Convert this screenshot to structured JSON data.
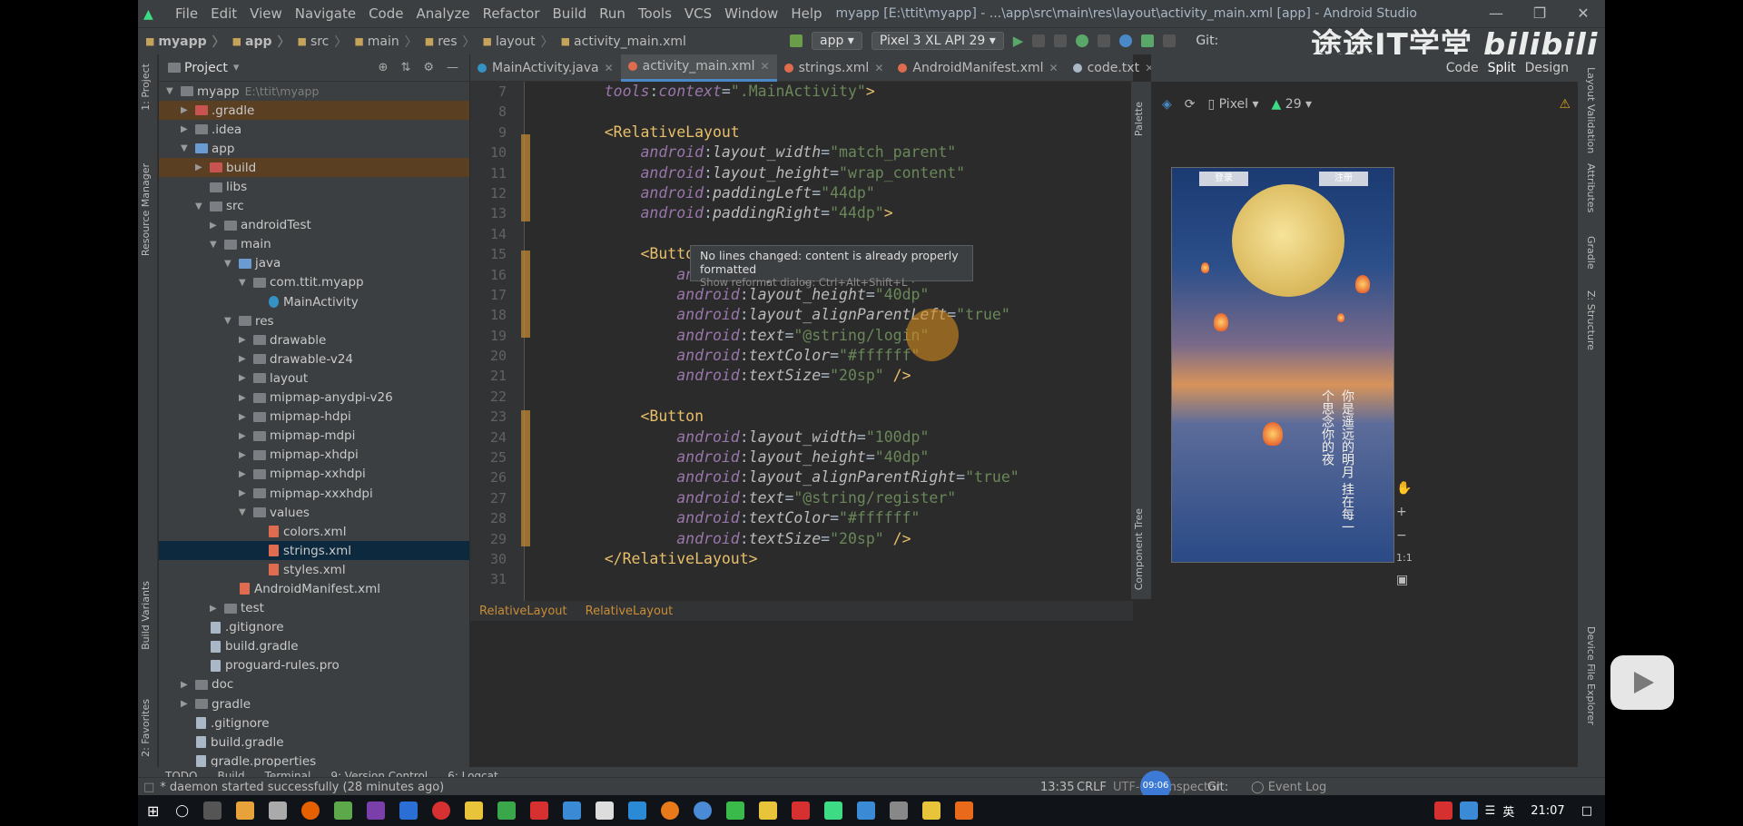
{
  "window": {
    "menu": [
      "File",
      "Edit",
      "View",
      "Navigate",
      "Code",
      "Analyze",
      "Refactor",
      "Build",
      "Run",
      "Tools",
      "VCS",
      "Window",
      "Help"
    ],
    "title": "myapp [E:\\ttit\\myapp] - ...\\app\\src\\main\\res\\layout\\activity_main.xml [app] - Android Studio"
  },
  "navbar": {
    "crumbs": [
      "myapp",
      "app",
      "src",
      "main",
      "res",
      "layout",
      "activity_main.xml"
    ],
    "run_config": "app",
    "device": "Pixel 3 XL API 29",
    "git_label": "Git:"
  },
  "watermark": {
    "text": "途途IT学堂",
    "brand": "bilibili"
  },
  "left_stripe": [
    "1: Project",
    "Resource Manager",
    "Build Variants",
    "2: Favorites"
  ],
  "project": {
    "title": "Project",
    "root_path": "E:\\ttit\\myapp",
    "tree": [
      {
        "label": "myapp",
        "depth": 0,
        "type": "folder",
        "expanded": true,
        "path": "E:\\ttit\\myapp"
      },
      {
        "label": ".gradle",
        "depth": 1,
        "type": "folder-red",
        "hl": true
      },
      {
        "label": ".idea",
        "depth": 1,
        "type": "folder"
      },
      {
        "label": "app",
        "depth": 1,
        "type": "folder-blue",
        "expanded": true
      },
      {
        "label": "build",
        "depth": 2,
        "type": "folder-red",
        "hl": true
      },
      {
        "label": "libs",
        "depth": 2,
        "type": "folder",
        "leaf": true
      },
      {
        "label": "src",
        "depth": 2,
        "type": "folder",
        "expanded": true
      },
      {
        "label": "androidTest",
        "depth": 3,
        "type": "folder"
      },
      {
        "label": "main",
        "depth": 3,
        "type": "folder",
        "expanded": true
      },
      {
        "label": "java",
        "depth": 4,
        "type": "folder-blue",
        "expanded": true
      },
      {
        "label": "com.ttit.myapp",
        "depth": 5,
        "type": "folder",
        "expanded": true
      },
      {
        "label": "MainActivity",
        "depth": 6,
        "type": "cls",
        "leaf": true
      },
      {
        "label": "res",
        "depth": 4,
        "type": "folder",
        "expanded": true
      },
      {
        "label": "drawable",
        "depth": 5,
        "type": "folder"
      },
      {
        "label": "drawable-v24",
        "depth": 5,
        "type": "folder"
      },
      {
        "label": "layout",
        "depth": 5,
        "type": "folder"
      },
      {
        "label": "mipmap-anydpi-v26",
        "depth": 5,
        "type": "folder"
      },
      {
        "label": "mipmap-hdpi",
        "depth": 5,
        "type": "folder"
      },
      {
        "label": "mipmap-mdpi",
        "depth": 5,
        "type": "folder"
      },
      {
        "label": "mipmap-xhdpi",
        "depth": 5,
        "type": "folder"
      },
      {
        "label": "mipmap-xxhdpi",
        "depth": 5,
        "type": "folder"
      },
      {
        "label": "mipmap-xxxhdpi",
        "depth": 5,
        "type": "folder"
      },
      {
        "label": "values",
        "depth": 5,
        "type": "folder",
        "expanded": true
      },
      {
        "label": "colors.xml",
        "depth": 6,
        "type": "xml",
        "leaf": true
      },
      {
        "label": "strings.xml",
        "depth": 6,
        "type": "xml",
        "leaf": true,
        "sel": true
      },
      {
        "label": "styles.xml",
        "depth": 6,
        "type": "xml",
        "leaf": true
      },
      {
        "label": "AndroidManifest.xml",
        "depth": 4,
        "type": "xml",
        "leaf": true
      },
      {
        "label": "test",
        "depth": 3,
        "type": "folder"
      },
      {
        "label": ".gitignore",
        "depth": 2,
        "type": "file",
        "leaf": true
      },
      {
        "label": "build.gradle",
        "depth": 2,
        "type": "file",
        "leaf": true
      },
      {
        "label": "proguard-rules.pro",
        "depth": 2,
        "type": "file",
        "leaf": true
      },
      {
        "label": "doc",
        "depth": 1,
        "type": "folder"
      },
      {
        "label": "gradle",
        "depth": 1,
        "type": "folder"
      },
      {
        "label": ".gitignore",
        "depth": 1,
        "type": "file",
        "leaf": true
      },
      {
        "label": "build.gradle",
        "depth": 1,
        "type": "file",
        "leaf": true
      },
      {
        "label": "gradle.properties",
        "depth": 1,
        "type": "file",
        "leaf": true
      }
    ]
  },
  "tabs": [
    {
      "label": "MainActivity.java",
      "color": "#3592c4"
    },
    {
      "label": "activity_main.xml",
      "color": "#e06c4f",
      "active": true
    },
    {
      "label": "strings.xml",
      "color": "#e06c4f"
    },
    {
      "label": "AndroidManifest.xml",
      "color": "#e06c4f"
    },
    {
      "label": "code.txt",
      "color": "#a9b7c6"
    }
  ],
  "editor": {
    "first_line": 7,
    "lines": [
      [
        [
          "ns",
          "    tools"
        ],
        [
          "pun",
          ":"
        ],
        [
          "ns",
          "context"
        ],
        [
          "pun",
          "="
        ],
        [
          "str",
          "\".MainActivity\""
        ],
        [
          "tag",
          ">"
        ]
      ],
      [],
      [
        [
          "tag",
          "    <RelativeLayout"
        ]
      ],
      [
        [
          "ns",
          "        android"
        ],
        [
          "pun",
          ":"
        ],
        [
          "attr",
          "layout_width"
        ],
        [
          "pun",
          "="
        ],
        [
          "str",
          "\"match_parent\""
        ]
      ],
      [
        [
          "ns",
          "        android"
        ],
        [
          "pun",
          ":"
        ],
        [
          "attr",
          "layout_height"
        ],
        [
          "pun",
          "="
        ],
        [
          "str",
          "\"wrap_content\""
        ]
      ],
      [
        [
          "ns",
          "        android"
        ],
        [
          "pun",
          ":"
        ],
        [
          "attr",
          "paddingLeft"
        ],
        [
          "pun",
          "="
        ],
        [
          "str",
          "\"44dp\""
        ]
      ],
      [
        [
          "ns",
          "        android"
        ],
        [
          "pun",
          ":"
        ],
        [
          "attr",
          "paddingRight"
        ],
        [
          "pun",
          "="
        ],
        [
          "str",
          "\"44dp\""
        ],
        [
          "tag",
          ">"
        ]
      ],
      [],
      [
        [
          "tag",
          "        <Button"
        ]
      ],
      [
        [
          "ns",
          "            android"
        ],
        [
          "pun",
          ":"
        ],
        [
          "attr",
          "layout_width"
        ],
        [
          "pun",
          "="
        ],
        [
          "str",
          "\"100dp\""
        ]
      ],
      [
        [
          "ns",
          "            android"
        ],
        [
          "pun",
          ":"
        ],
        [
          "attr",
          "layout_height"
        ],
        [
          "pun",
          "="
        ],
        [
          "str",
          "\"40dp\""
        ]
      ],
      [
        [
          "ns",
          "            android"
        ],
        [
          "pun",
          ":"
        ],
        [
          "attr",
          "layout_alignParentLeft"
        ],
        [
          "pun",
          "="
        ],
        [
          "str",
          "\"true\""
        ]
      ],
      [
        [
          "ns",
          "            android"
        ],
        [
          "pun",
          ":"
        ],
        [
          "attr",
          "text"
        ],
        [
          "pun",
          "="
        ],
        [
          "str",
          "\"@string/login\""
        ]
      ],
      [
        [
          "ns",
          "            android"
        ],
        [
          "pun",
          ":"
        ],
        [
          "attr",
          "textColor"
        ],
        [
          "pun",
          "="
        ],
        [
          "str",
          "\"#ffffff\""
        ]
      ],
      [
        [
          "ns",
          "            android"
        ],
        [
          "pun",
          ":"
        ],
        [
          "attr",
          "textSize"
        ],
        [
          "pun",
          "="
        ],
        [
          "str",
          "\"20sp\""
        ],
        [
          "tag",
          " />"
        ]
      ],
      [],
      [
        [
          "tag",
          "        <Button"
        ]
      ],
      [
        [
          "ns",
          "            android"
        ],
        [
          "pun",
          ":"
        ],
        [
          "attr",
          "layout_width"
        ],
        [
          "pun",
          "="
        ],
        [
          "str",
          "\"100dp\""
        ]
      ],
      [
        [
          "ns",
          "            android"
        ],
        [
          "pun",
          ":"
        ],
        [
          "attr",
          "layout_height"
        ],
        [
          "pun",
          "="
        ],
        [
          "str",
          "\"40dp\""
        ]
      ],
      [
        [
          "ns",
          "            android"
        ],
        [
          "pun",
          ":"
        ],
        [
          "attr",
          "layout_alignParentRight"
        ],
        [
          "pun",
          "="
        ],
        [
          "str",
          "\"true\""
        ]
      ],
      [
        [
          "ns",
          "            android"
        ],
        [
          "pun",
          ":"
        ],
        [
          "attr",
          "text"
        ],
        [
          "pun",
          "="
        ],
        [
          "str",
          "\"@string/register\""
        ]
      ],
      [
        [
          "ns",
          "            android"
        ],
        [
          "pun",
          ":"
        ],
        [
          "attr",
          "textColor"
        ],
        [
          "pun",
          "="
        ],
        [
          "str",
          "\"#ffffff\""
        ]
      ],
      [
        [
          "ns",
          "            android"
        ],
        [
          "pun",
          ":"
        ],
        [
          "attr",
          "textSize"
        ],
        [
          "pun",
          "="
        ],
        [
          "str",
          "\"20sp\""
        ],
        [
          "tag",
          " />"
        ]
      ],
      [
        [
          "tag",
          "    </RelativeLayout>"
        ]
      ],
      []
    ],
    "tooltip_title": "No lines changed: content is already properly formatted",
    "tooltip_hint": "Show reformat dialog: Ctrl+Alt+Shift+L"
  },
  "breadcrumb": [
    "RelativeLayout",
    "RelativeLayout"
  ],
  "design": {
    "modes": [
      "Code",
      "Split",
      "Design"
    ],
    "device": "Pixel",
    "api": "29",
    "buttons": [
      "登录",
      "注册"
    ],
    "poem": "你是遥远的明月 挂在每一个思念你的夜",
    "zoom_fit": "1:1",
    "side_tabs": [
      "Palette",
      "Component Tree"
    ],
    "right_tabs": [
      "Layout Validation",
      "Attributes",
      "Gradle",
      "Z: Structure",
      "Device File Explorer"
    ]
  },
  "bottom_tools": [
    "TODO",
    "Build",
    "Terminal",
    "9: Version Control",
    "6: Logcat"
  ],
  "status": {
    "message": "* daemon started successfully (28 minutes ago)",
    "position": "13:35",
    "line_sep": "CRLF",
    "encoding": "UTF-8",
    "git": "Git:",
    "inspector": "Inspector",
    "event_log": "Event Log",
    "timer": "09:06"
  },
  "taskbar": {
    "time": "21:07",
    "ime": "英"
  },
  "colors": {
    "bg": "#2b2b2b",
    "panel": "#3c3f41",
    "accent": "#4a88c7"
  }
}
